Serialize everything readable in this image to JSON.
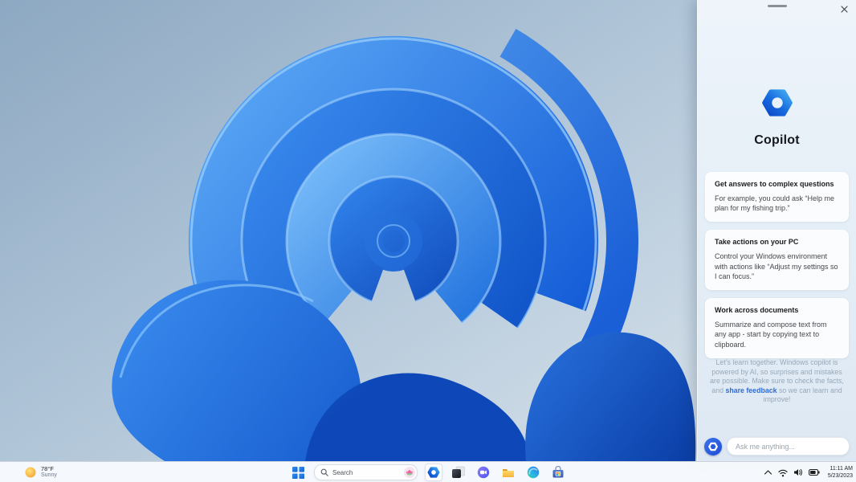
{
  "copilot_panel": {
    "title": "Copilot",
    "cards": [
      {
        "title": "Get answers to complex questions",
        "body": "For example, you could ask “Help me plan for my fishing trip.”"
      },
      {
        "title": "Take actions on your PC",
        "body": "Control your Windows environment with actions like “Adjust my settings so I can focus.”"
      },
      {
        "title": "Work across documents",
        "body": "Summarize and compose text from any app - start by copying text to clipboard."
      }
    ],
    "disclaimer": {
      "text_before": "Let’s learn together. Windows copilot is powered by AI, so surprises and mistakes are possible. Make sure to check the facts, and ",
      "link": "share feedback",
      "text_after": " so we can learn and improve!"
    },
    "input": {
      "placeholder": "Ask me anything..."
    }
  },
  "taskbar": {
    "weather": {
      "temp": "78°F",
      "condition": "Sunny"
    },
    "search": {
      "label": "Search"
    },
    "apps": [
      "copilot",
      "task-view",
      "chat",
      "file-explorer",
      "edge",
      "store"
    ],
    "tray": {
      "time": "11:11 AM",
      "date": "5/23/2023"
    }
  },
  "icons": {
    "panel": [
      "drag-handle",
      "close-icon",
      "copilot-logo-icon",
      "copilot-badge-icon"
    ],
    "taskbar": [
      "sun-icon",
      "start-icon",
      "search-icon",
      "search-highlight-flower-icon",
      "copilot-icon",
      "task-view-icon",
      "chat-icon",
      "file-explorer-icon",
      "edge-icon",
      "store-icon"
    ],
    "tray": [
      "chevron-up-icon",
      "wifi-icon",
      "volume-icon",
      "battery-icon"
    ]
  },
  "colors": {
    "accent_blue": "#2b6bd8",
    "link_blue": "#2e6bd6",
    "bloom_blue": "#1565d8",
    "panel_bg": "#e8f1f9",
    "taskbar_bg": "#f7fafd"
  }
}
